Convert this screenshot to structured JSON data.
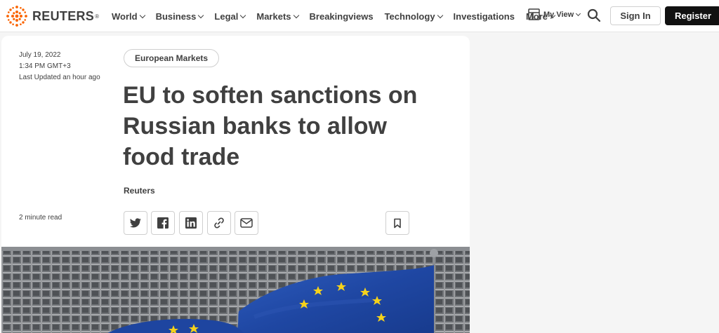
{
  "header": {
    "logo_text": "REUTERS",
    "logo_mark": "®",
    "nav": [
      {
        "label": "World",
        "has_dropdown": true
      },
      {
        "label": "Business",
        "has_dropdown": true
      },
      {
        "label": "Legal",
        "has_dropdown": true
      },
      {
        "label": "Markets",
        "has_dropdown": true
      },
      {
        "label": "Breakingviews",
        "has_dropdown": false
      },
      {
        "label": "Technology",
        "has_dropdown": true
      },
      {
        "label": "Investigations",
        "has_dropdown": false
      },
      {
        "label": "More",
        "has_dropdown": true
      }
    ],
    "my_view_label": "My View",
    "sign_in_label": "Sign In",
    "register_label": "Register",
    "colors": {
      "brand": "#fa6400",
      "register_bg": "#111111"
    }
  },
  "article": {
    "date": "July 19, 2022",
    "time": "1:34 PM GMT+3",
    "updated": "Last Updated an hour ago",
    "topic": "European Markets",
    "headline": "EU to soften sanctions on Russian banks to allow food trade",
    "byline": "Reuters",
    "read_time": "2 minute read",
    "share_icons": [
      "twitter-icon",
      "facebook-icon",
      "linkedin-icon",
      "link-icon",
      "email-icon"
    ],
    "bookmark_icon": "bookmark-icon"
  }
}
